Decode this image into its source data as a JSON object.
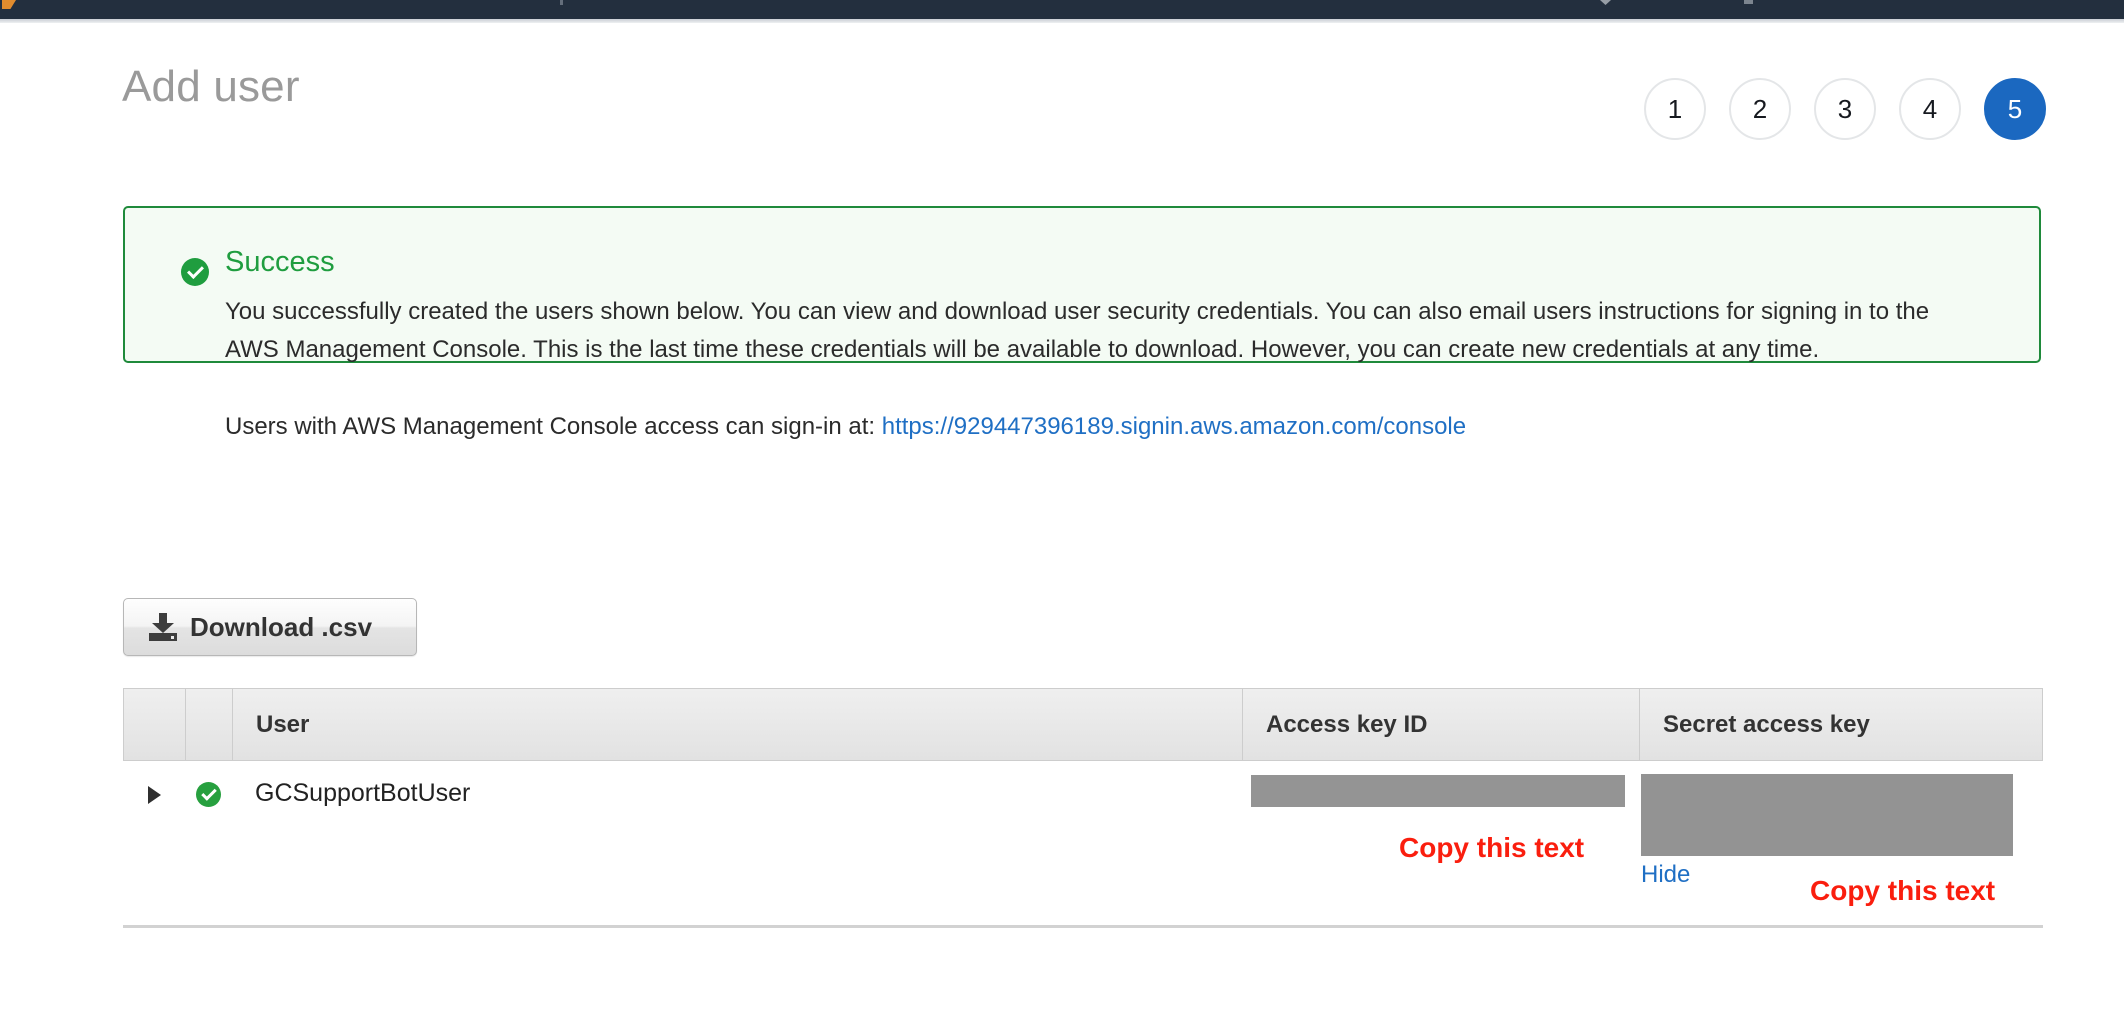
{
  "topbar": {
    "background": "#232f3e",
    "logo_icon": "aws-logo-icon"
  },
  "header": {
    "title": "Add user"
  },
  "steps": {
    "items": [
      {
        "label": "1",
        "active": false
      },
      {
        "label": "2",
        "active": false
      },
      {
        "label": "3",
        "active": false
      },
      {
        "label": "4",
        "active": false
      },
      {
        "label": "5",
        "active": true
      }
    ],
    "active_color": "#1b68c0"
  },
  "alert": {
    "type": "success",
    "icon": "check-circle-icon",
    "title": "Success",
    "border_color": "#1f8a3b",
    "background_color": "#f4fbf4",
    "title_color": "#1f9d3f",
    "body": "You successfully created the users shown below. You can view and download user security credentials. You can also email users instructions for signing in to the AWS Management Console. This is the last time these credentials will be available to download. However, you can create new credentials at any time.",
    "signin_prefix": "Users with AWS Management Console access can sign-in at: ",
    "signin_url": "https://929447396189.signin.aws.amazon.com/console",
    "link_color": "#1f6fc4"
  },
  "download_button": {
    "label": "Download .csv",
    "icon": "download-icon"
  },
  "table": {
    "columns": [
      {
        "key": "expand",
        "label": ""
      },
      {
        "key": "status",
        "label": ""
      },
      {
        "key": "user",
        "label": "User"
      },
      {
        "key": "access_key_id",
        "label": "Access key ID"
      },
      {
        "key": "secret_access_key",
        "label": "Secret access key"
      }
    ],
    "rows": [
      {
        "expander_icon": "triangle-right-icon",
        "status_icon": "check-circle-icon",
        "user": "GCSupportBotUser",
        "access_key_id": "",
        "secret_access_key": "",
        "secret_toggle_label": "Hide"
      }
    ]
  },
  "annotations": {
    "color": "#fa1e0e",
    "access_key_note": "Copy this text",
    "secret_key_note": "Copy this text"
  }
}
